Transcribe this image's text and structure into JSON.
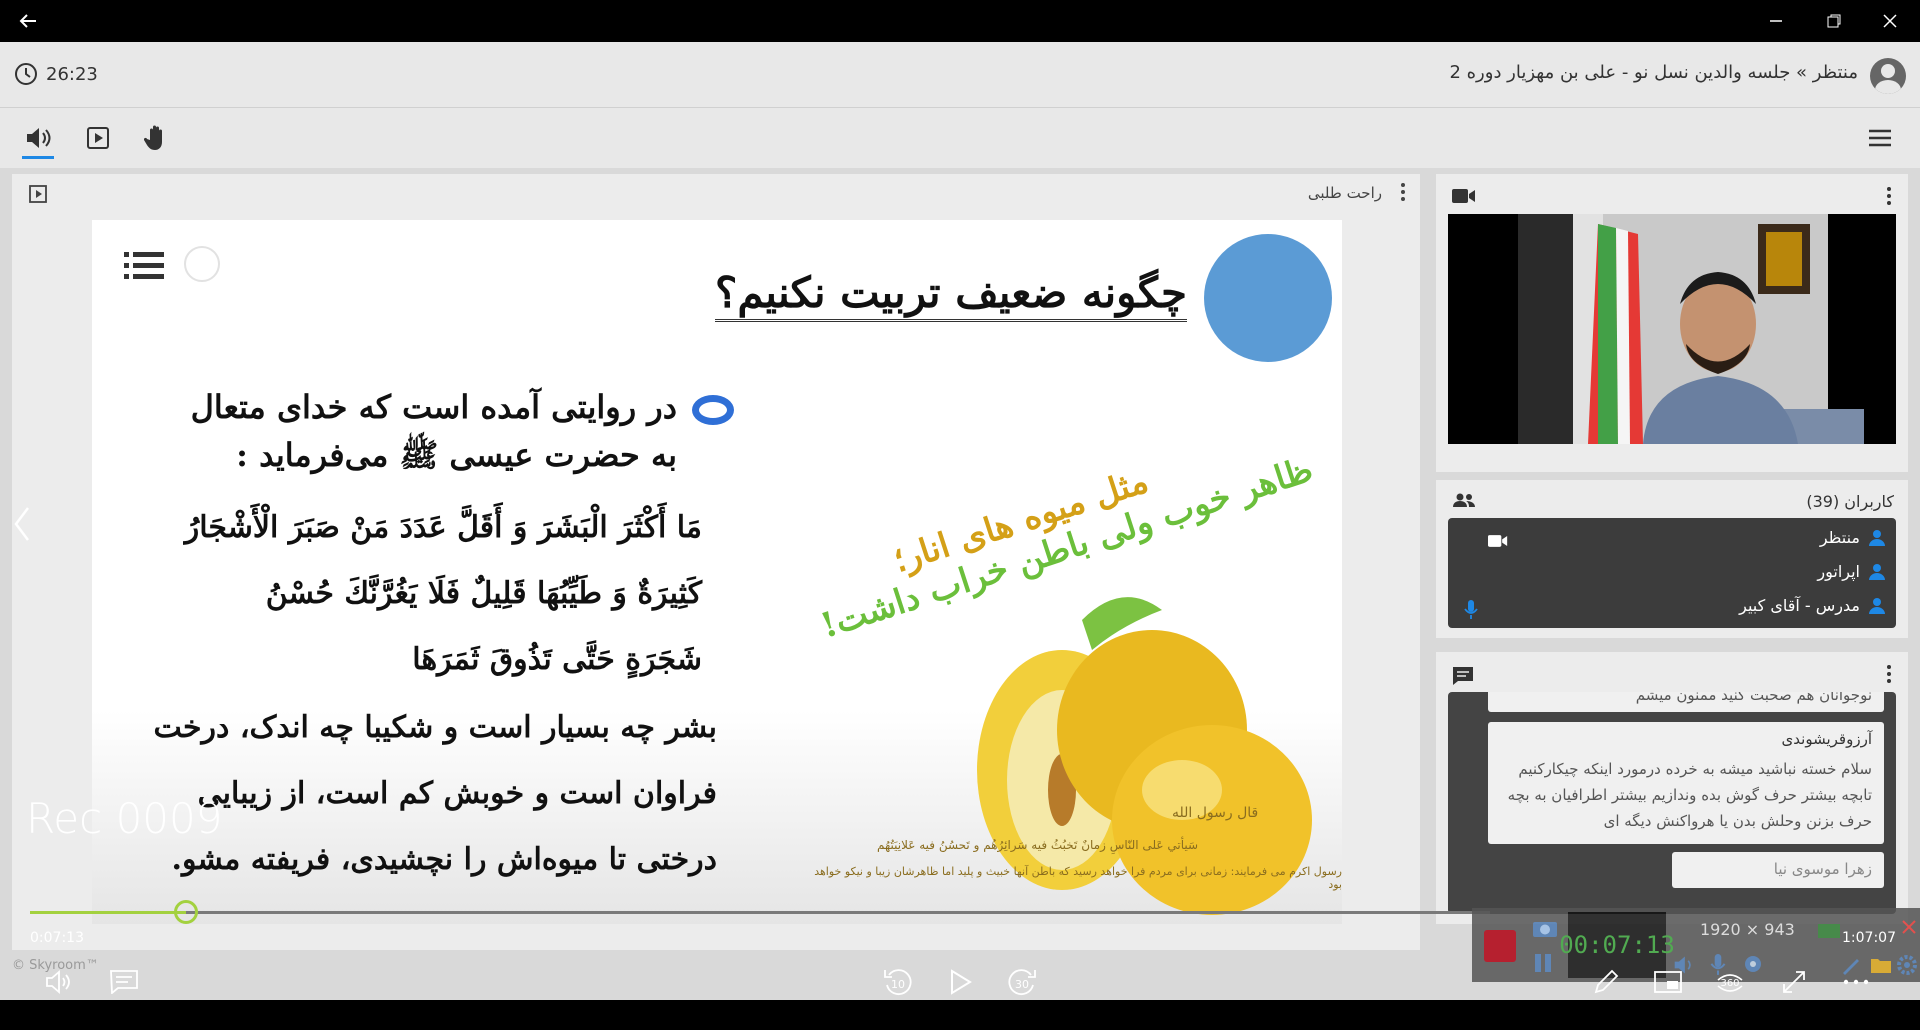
{
  "window": {
    "back": "←",
    "minimize": "—",
    "restore": "❐",
    "close": "✕"
  },
  "header": {
    "timer": "26:23",
    "room_title": "منتظر » جلسه والدین نسل نو - علی بن مهزیار دوره 2"
  },
  "presentation": {
    "presenter": "راحت طلبی",
    "slide": {
      "title": "چگونه ضعیف تربیت نکنیم؟",
      "lines": [
        "در روایتی آمده است که خدای متعال",
        "به حضرت عیسی ﷺ می‌فرماید :",
        "مَا أَكْثَرَ الْبَشَرَ وَ أَقَلَّ عَدَدَ مَنْ صَبَرَ الْأَشْجَارُ",
        "كَثِيرَةٌ وَ طَيِّبُهَا قَلِيلٌ فَلَا يَغُرَّنَّكَ حُسْنُ",
        "شَجَرَةٍ حَتَّى تَذُوقَ ثَمَرَهَا",
        "بشر چه بسیار است و شکیبا چه اندک، درخت",
        "فراوان است و خوبش کم است، از زیبایی",
        "درختی تا میوه‌اش را نچشیدی، فریفته مشو."
      ],
      "fruit_text_1": "مثل میوه های انار؛",
      "fruit_text_2": "ظاهر خوب ولی باطن خراب داشت!",
      "quote_1": "قال رسول الله",
      "quote_2": "سَيأتي عَلى النّاسِ زمانٌ تَخبُثُ فيه سَرائِرُهُم و تَحسُنُ فيه عَلانِيَتُهُم",
      "quote_3": "رسول اکرم می فرمایند: زمانی برای مردم فرا خواهد رسید که باطن آنها خبیث و پلید اما ظاهرشان زیبا و نیکو خواهد بود"
    }
  },
  "users": {
    "title": "کاربران (39)",
    "items": [
      {
        "name": "منتظر"
      },
      {
        "name": "اپراتور"
      },
      {
        "name": "مدرس - آقای کبیر"
      }
    ]
  },
  "chat": {
    "messages": [
      {
        "text": "نوجوانان هم صحبت کنید ممنون میشم"
      },
      {
        "author": "آرزوقریشوندی",
        "text": "سلام خسته نباشید میشه به خرده درمورد اینکه چیکارکنیم تابچه بیشتر حرف گوش بده وندازیم بیشتر اطرافیان به بچه حرف بزنن وحلش بدن یا هرواکنش دیگه ای"
      },
      {
        "author": "زهرا موسوی نیا"
      }
    ]
  },
  "player": {
    "rec_label": "Rec 0009",
    "current_time": "0:07:13",
    "total_time": "1:07:07",
    "progress": 0.107,
    "watermark": "© Skyroom™",
    "skip_back": "10",
    "skip_forward": "30",
    "vr_label": "360"
  },
  "recorder": {
    "time": "00:07:13",
    "resolution": "1920 × 943"
  },
  "colors": {
    "accent": "#1e88e5",
    "progress": "#a3d13f",
    "user_icon": "#1e88e5",
    "record": "#b00012"
  }
}
